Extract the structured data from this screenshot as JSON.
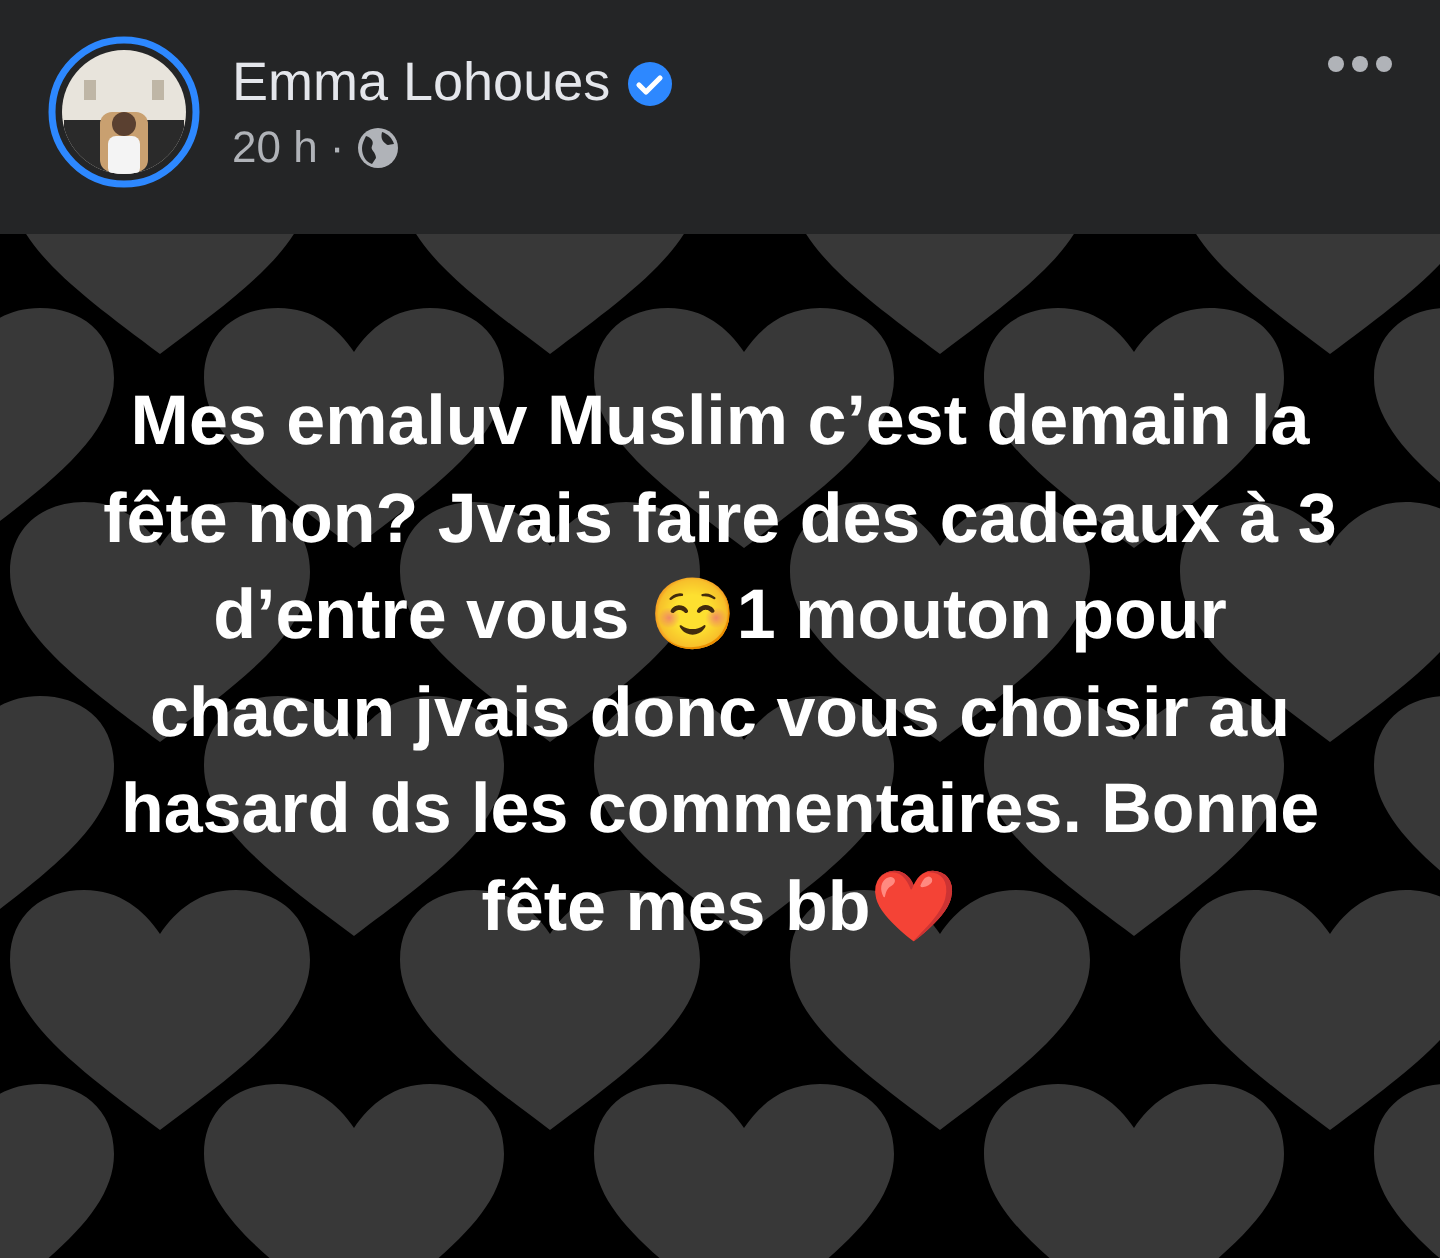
{
  "post": {
    "author": "Emma Lohoues",
    "verified": true,
    "time": "20 h",
    "separator": "·",
    "text": "Mes emaluv Muslim c’est demain la fête non? Jvais faire des cadeaux à 3 d’entre vous ☺️1 mouton pour chacun jvais donc vous choisir au hasard ds les commentaires. Bonne fête mes bb❤️"
  }
}
